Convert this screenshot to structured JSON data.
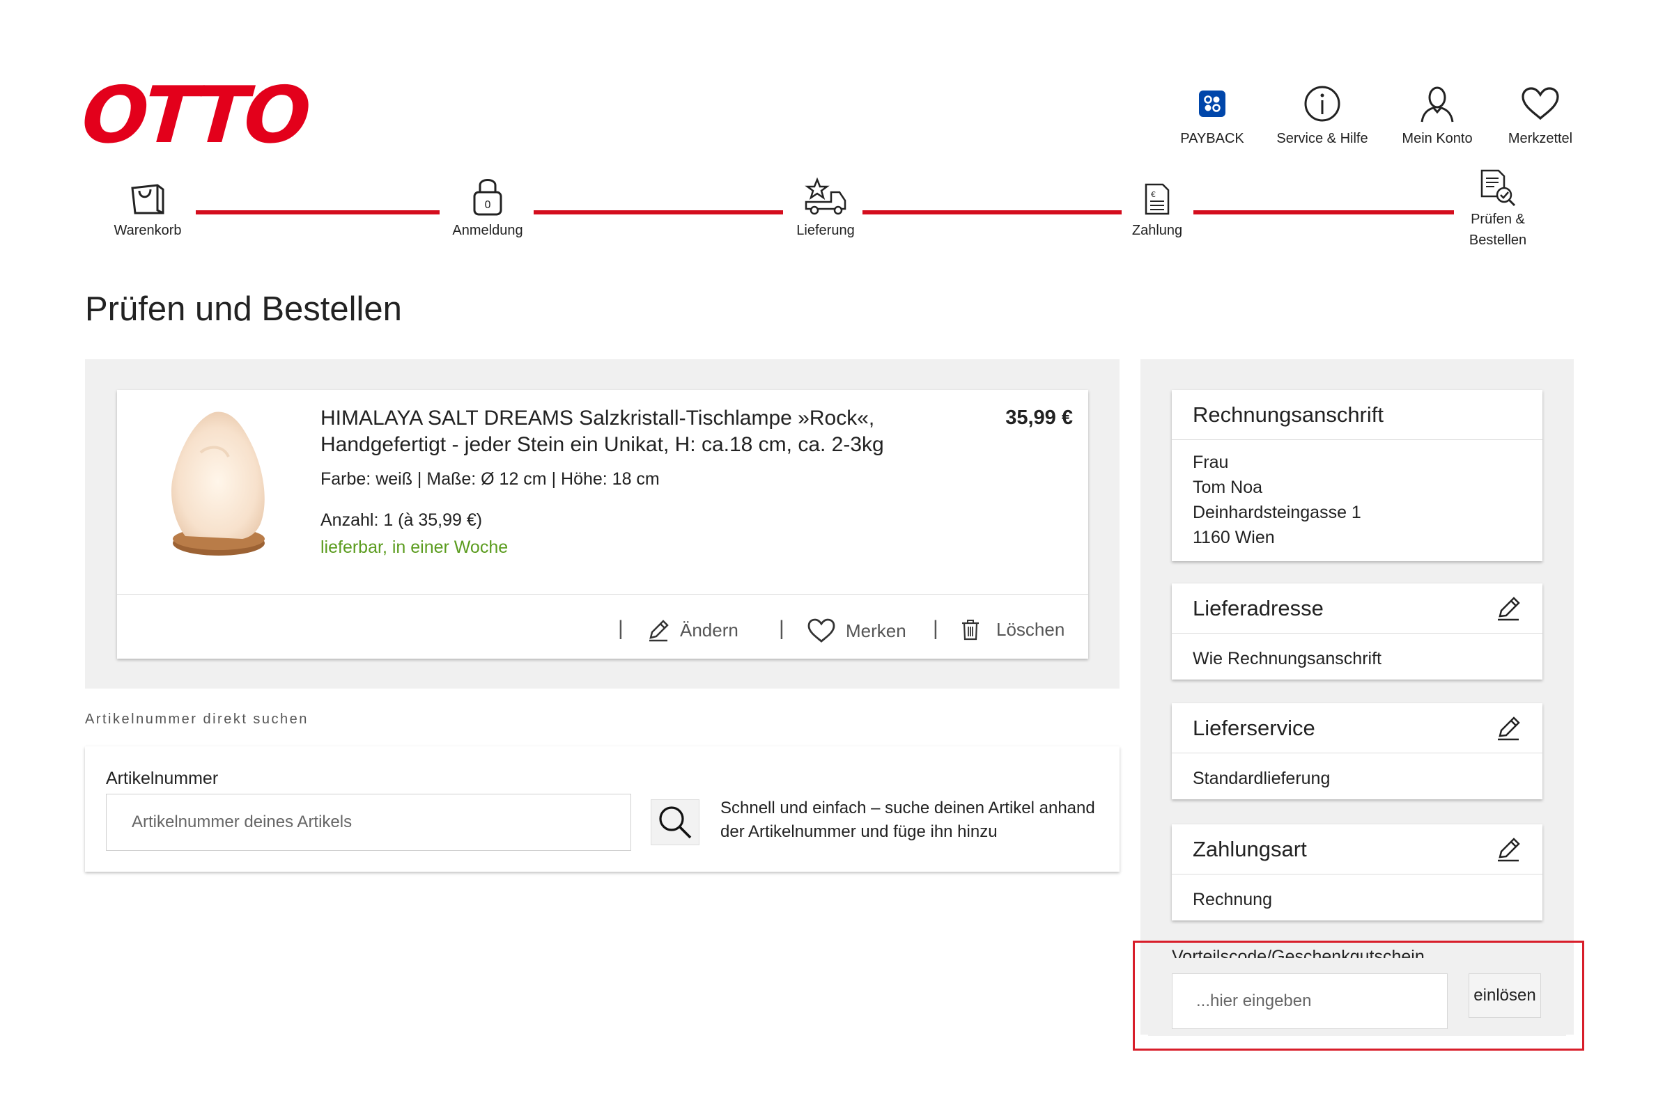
{
  "brand": {
    "logo_text": "OTTO",
    "accent_color": "#e3001b"
  },
  "top_nav": [
    {
      "label": "PAYBACK",
      "icon": "payback-icon"
    },
    {
      "label": "Service & Hilfe",
      "icon": "info-icon"
    },
    {
      "label": "Mein Konto",
      "icon": "user-icon"
    },
    {
      "label": "Merkzettel",
      "icon": "heart-icon"
    }
  ],
  "steps": [
    {
      "label": "Warenkorb",
      "icon": "bag-icon"
    },
    {
      "label": "Anmeldung",
      "icon": "lock-icon"
    },
    {
      "label": "Lieferung",
      "icon": "truck-icon"
    },
    {
      "label": "Zahlung",
      "icon": "invoice-icon"
    },
    {
      "label_line1": "Prüfen &",
      "label_line2": "Bestellen",
      "icon": "document-check-icon"
    }
  ],
  "page_title": "Prüfen und Bestellen",
  "product": {
    "name": "HIMALAYA SALT DREAMS Salzkristall-Tischlampe »Rock«, Handgefertigt - jeder Stein ein Unikat, H: ca.18 cm, ca. 2-3kg",
    "price": "35,99 €",
    "attributes": "Farbe: weiß | Maße: Ø 12 cm | Höhe: 18 cm",
    "quantity": "Anzahl: 1 (à 35,99 €)",
    "availability": "lieferbar, in einer Woche",
    "availability_color": "#5b9c1f",
    "actions": {
      "edit": "Ändern",
      "save": "Merken",
      "delete": "Löschen"
    },
    "separator": "|"
  },
  "article_search": {
    "heading": "Artikelnummer direkt suchen",
    "label": "Artikelnummer",
    "placeholder": "Artikelnummer deines Artikels",
    "hint": "Schnell und einfach – suche deinen Artikel anhand der Artikelnummer und füge ihn hinzu"
  },
  "billing": {
    "title": "Rechnungsanschrift",
    "lines": [
      "Frau",
      "Tom Noa",
      "Deinhardsteingasse 1",
      "1160 Wien"
    ]
  },
  "delivery_address": {
    "title": "Lieferadresse",
    "value": "Wie Rechnungsanschrift"
  },
  "delivery_service": {
    "title": "Lieferservice",
    "value": "Standardlieferung"
  },
  "payment": {
    "title": "Zahlungsart",
    "value": "Rechnung"
  },
  "voucher": {
    "label": "Vorteilscode/Geschenkgutschein",
    "placeholder": "...hier eingeben",
    "button": "einlösen",
    "highlight_color": "#d81e2a"
  }
}
